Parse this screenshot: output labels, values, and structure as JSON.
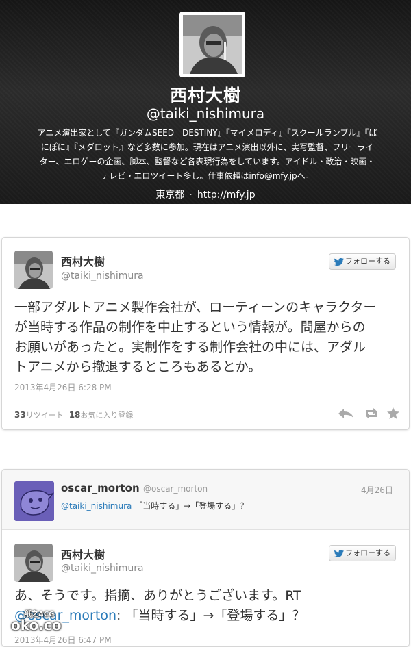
{
  "profile": {
    "name": "西村大樹",
    "handle": "@taiki_nishimura",
    "bio_lines": [
      "アニメ演出家として『ガンダムSEED　DESTINY』『マイメロディ』『スクールランブル』『ぱ",
      "にぽに』『メダロット』など多数に参加。現在はアニメ演出以外に、実写監督、フリーライ",
      "ター、エロゲーの企画、脚本、監督など各表現行為をしています。アイドル・政治・映画・",
      "テレビ・エロツイート多し。仕事依頼はinfo@mfy.jpへ。"
    ],
    "location": "東京都",
    "separator": "·",
    "url": "http://mfy.jp"
  },
  "tweet1": {
    "name": "西村大樹",
    "handle": "@taiki_nishimura",
    "follow_label": "フォローする",
    "text_lines": [
      "一部アダルトアニメ製作会社が、ローティーンのキャラクター",
      "が当時する作品の制作を中止するという情報が。問屋からの",
      "お願いがあったと。実制作をする制作会社の中には、アダル",
      "トアニメから撤退するところもあるとか。"
    ],
    "timestamp": "2013年4月26日 6:28 PM",
    "retweet_count": "33",
    "retweet_label": "リツイート",
    "favorite_count": "18",
    "favorite_label": "お気に入り登録"
  },
  "reply": {
    "name": "oscar_morton",
    "handle": "@oscar_morton",
    "date": "4月26日",
    "mention": "@taiki_nishimura",
    "text": " 「当時する」→「登場する」？"
  },
  "tweet2": {
    "name": "西村大樹",
    "handle": "@taiki_nishimura",
    "follow_label": "フォローする",
    "line1": "あ、そうです。指摘、ありがとうございます。RT",
    "mention_partial": "@oscar_morton",
    "line2_rest": ": 「当時する」→「登場する」？",
    "timestamp_partial": "2013年4月26日 6:47 PM"
  },
  "watermark": {
    "small": "纸之ACG",
    "big": "oko.co"
  },
  "colors": {
    "link": "#2b7bb9",
    "header_bg": "#1f1f1f",
    "reply_avatar": "#6a5fb8"
  }
}
